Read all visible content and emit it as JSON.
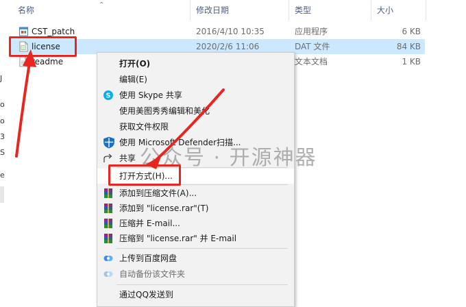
{
  "header": {
    "name": "名称",
    "date": "修改日期",
    "type": "类型",
    "size": "大小"
  },
  "files": [
    {
      "name": "CST_patch",
      "date": "2016/4/10 10:35",
      "type": "应用程序",
      "size": "6 KB"
    },
    {
      "name": "license",
      "date": "2020/2/6 11:06",
      "type": "DAT 文件",
      "size": "84 KB"
    },
    {
      "name": "readme",
      "date": "",
      "type": "文本文档",
      "size": "1 KB"
    }
  ],
  "left_fragments": [
    "J",
    "o",
    "o",
    "3",
    "S",
    "e"
  ],
  "menu": {
    "items": [
      {
        "label": "打开(O)"
      },
      {
        "label": "编辑(E)"
      },
      {
        "label": "使用 Skype 共享"
      },
      {
        "label": "使用美图秀秀编辑和美化"
      },
      {
        "label": "获取文件权限"
      },
      {
        "label": "使用 Microsoft Defender扫描..."
      },
      {
        "label": "共享"
      },
      {
        "label": "打开方式(H)..."
      },
      {
        "label": "添加到压缩文件(A)..."
      },
      {
        "label": "添加到 \"license.rar\"(T)"
      },
      {
        "label": "压缩并 E-mail..."
      },
      {
        "label": "压缩到 \"license.rar\" 并 E-mail"
      },
      {
        "label": "上传到百度网盘"
      },
      {
        "label": "自动备份该文件夹"
      },
      {
        "label": "通过QQ发送到"
      }
    ]
  },
  "watermark": "公众号 · 开源神器",
  "colors": {
    "selection": "#cce8ff",
    "annotation_red": "#e8261f",
    "menu_bg": "#f2f2f2",
    "header_text": "#4d6082"
  }
}
